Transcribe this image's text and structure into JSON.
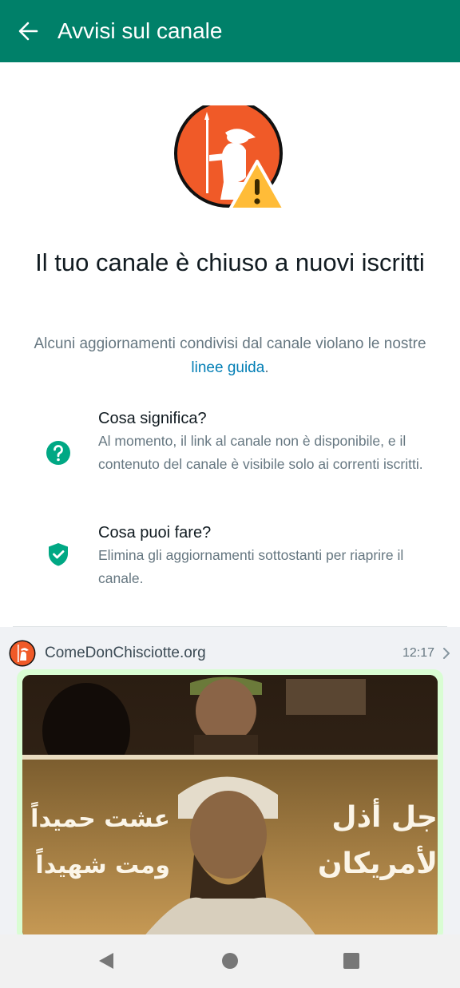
{
  "appbar": {
    "title": "Avvisi sul canale"
  },
  "notice": {
    "headline": "Il tuo canale è chiuso a nuovi iscritti",
    "description": "Alcuni aggiornamenti condivisi dal canale violano le nostre",
    "link_text": "linee guida",
    "description_end": "."
  },
  "info_items": [
    {
      "title": "Cosa significa?",
      "body": "Al momento, il link al canale non è disponibile, e il contenuto del canale è visibile solo ai correnti iscritti.",
      "icon": "question-circle-icon"
    },
    {
      "title": "Cosa puoi fare?",
      "body": "Elimina gli aggiornamenti sottostanti per riaprire il canale.",
      "icon": "shield-check-icon"
    }
  ],
  "feed": {
    "channel_name": "ComeDonChisciotte.org",
    "time": "12:17",
    "image_text_left_1": "عشت حميداً",
    "image_text_left_2": "ومت شهيداً",
    "image_text_right_1": "جل أذل",
    "image_text_right_2": "لأمريكان"
  },
  "colors": {
    "primary": "#008069",
    "accent_orange": "#f05a28",
    "warning_yellow": "#ffbc38",
    "link": "#027eb5",
    "bubble": "#d9fdd3"
  },
  "navbar": {
    "back": "back-triangle-icon",
    "home": "home-circle-icon",
    "recents": "recents-square-icon"
  }
}
